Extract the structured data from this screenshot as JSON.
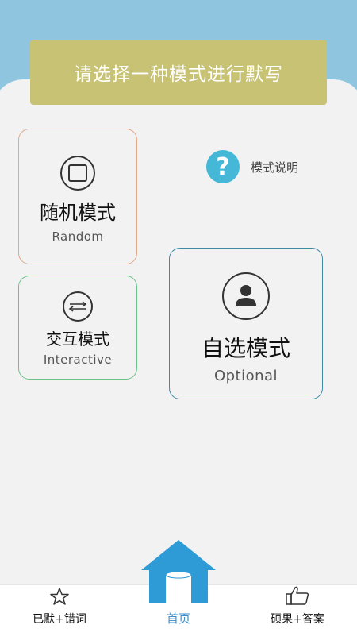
{
  "header": {
    "title": "请选择一种模式进行默写"
  },
  "modes": {
    "random": {
      "title": "随机模式",
      "subtitle": "Random"
    },
    "interactive": {
      "title": "交互模式",
      "subtitle": "Interactive"
    },
    "optional": {
      "title": "自选模式",
      "subtitle": "Optional"
    }
  },
  "help": {
    "label": "模式说明",
    "icon": "question-mark-icon"
  },
  "tabbar": {
    "left_label": "已默+错词",
    "home_label": "首页",
    "right_label": "硕果+答案"
  },
  "colors": {
    "header_blue": "#8fc5df",
    "banner": "#c8c275",
    "random_border": "#e3a98a",
    "interactive_border": "#6cc38a",
    "optional_border": "#3f8aa5",
    "home_blue": "#2e9bd6",
    "help_blue": "#45b8d8"
  }
}
